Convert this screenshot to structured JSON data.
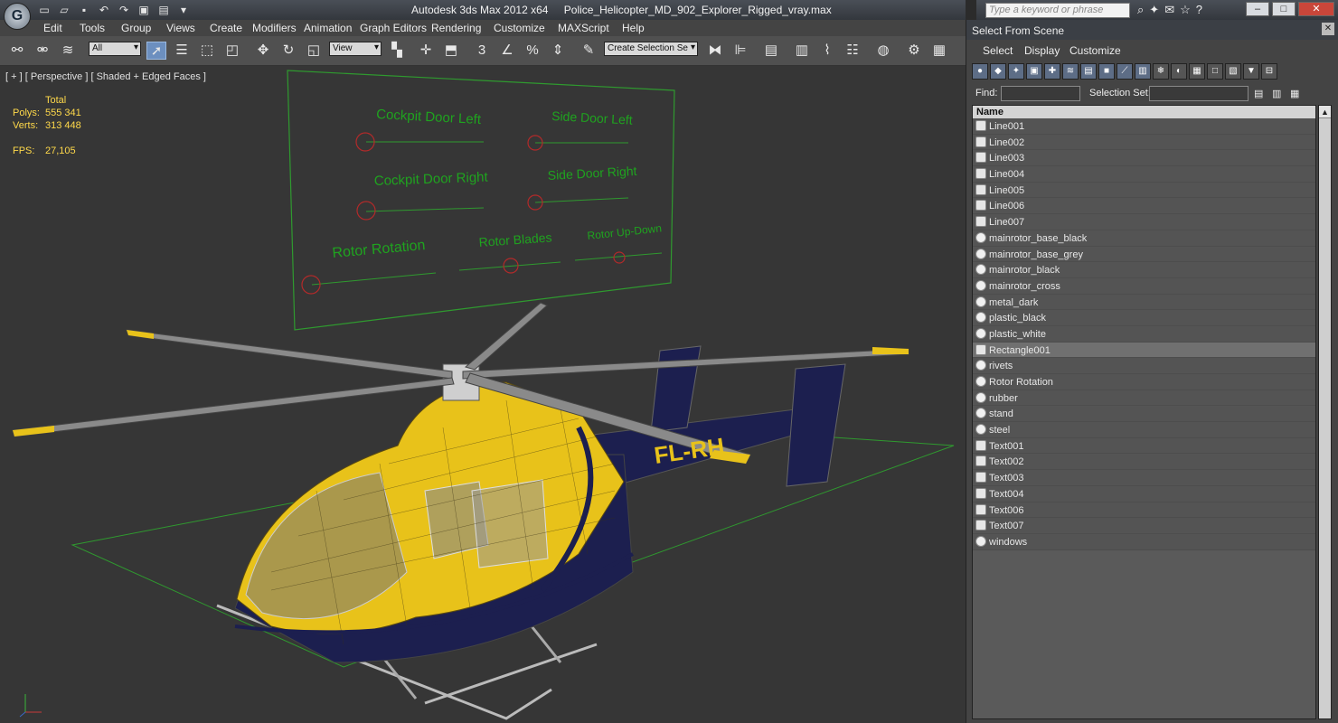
{
  "app": {
    "title_app": "Autodesk 3ds Max  2012 x64",
    "title_file": "Police_Helicopter_MD_902_Explorer_Rigged_vray.max",
    "search_placeholder": "Type a keyword or phrase"
  },
  "menu": [
    "Edit",
    "Tools",
    "Group",
    "Views",
    "Create",
    "Modifiers",
    "Animation",
    "Graph Editors",
    "Rendering",
    "Customize",
    "MAXScript",
    "Help"
  ],
  "toolbar": {
    "filter_value": "All",
    "ref_coord_value": "View",
    "selection_set_placeholder": "Create Selection Se"
  },
  "viewport": {
    "label": "[ + ] [ Perspective ] [ Shaded + Edged Faces ]",
    "stats": {
      "total_label": "Total",
      "polys_label": "Polys:",
      "polys_value": "555 341",
      "verts_label": "Verts:",
      "verts_value": "313 448",
      "fps_label": "FPS:",
      "fps_value": "27,105"
    },
    "rig_labels": {
      "cockpit_left": "Cockpit Door Left",
      "side_left": "Side Door Left",
      "cockpit_right": "Cockpit Door Right",
      "side_right": "Side Door Right",
      "rotor_rotation": "Rotor Rotation",
      "rotor_blades": "Rotor Blades",
      "rotor_updown": "Rotor Up-Down"
    },
    "decal_text": "FL-RH"
  },
  "panel": {
    "title": "Select From Scene",
    "menu": [
      "Select",
      "Display",
      "Customize"
    ],
    "find_label": "Find:",
    "selection_set_label": "Selection Set:",
    "column_header": "Name",
    "objects": [
      {
        "name": "Line001",
        "kind": "shape"
      },
      {
        "name": "Line002",
        "kind": "shape"
      },
      {
        "name": "Line003",
        "kind": "shape"
      },
      {
        "name": "Line004",
        "kind": "shape"
      },
      {
        "name": "Line005",
        "kind": "shape"
      },
      {
        "name": "Line006",
        "kind": "shape"
      },
      {
        "name": "Line007",
        "kind": "shape"
      },
      {
        "name": "mainrotor_base_black",
        "kind": "geometry"
      },
      {
        "name": "mainrotor_base_grey",
        "kind": "geometry"
      },
      {
        "name": "mainrotor_black",
        "kind": "geometry"
      },
      {
        "name": "mainrotor_cross",
        "kind": "geometry"
      },
      {
        "name": "metal_dark",
        "kind": "geometry"
      },
      {
        "name": "plastic_black",
        "kind": "geometry"
      },
      {
        "name": "plastic_white",
        "kind": "geometry"
      },
      {
        "name": "Rectangle001",
        "kind": "shape",
        "selected": true
      },
      {
        "name": "rivets",
        "kind": "geometry"
      },
      {
        "name": "Rotor Rotation",
        "kind": "geometry"
      },
      {
        "name": "rubber",
        "kind": "geometry"
      },
      {
        "name": "stand",
        "kind": "geometry"
      },
      {
        "name": "steel",
        "kind": "geometry"
      },
      {
        "name": "Text001",
        "kind": "shape"
      },
      {
        "name": "Text002",
        "kind": "shape"
      },
      {
        "name": "Text003",
        "kind": "shape"
      },
      {
        "name": "Text004",
        "kind": "shape"
      },
      {
        "name": "Text006",
        "kind": "shape"
      },
      {
        "name": "Text007",
        "kind": "shape"
      },
      {
        "name": "windows",
        "kind": "geometry"
      }
    ]
  },
  "colors": {
    "viewport_bg": "#363636",
    "stats_text": "#ffd94a",
    "rig_text": "#1fa31f",
    "helicopter_yellow": "#e8c21a",
    "helicopter_navy": "#1c1f4f",
    "wire_green": "#2f9a2f"
  }
}
